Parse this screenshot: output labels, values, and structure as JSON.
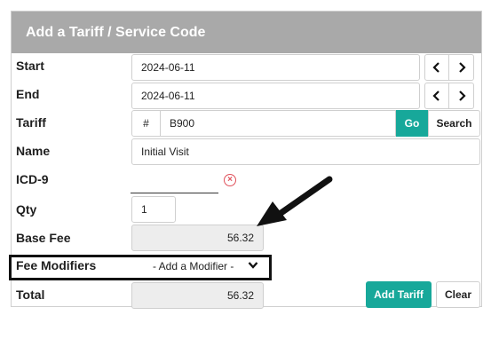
{
  "header": {
    "title": "Add a Tariff / Service Code"
  },
  "labels": {
    "start": "Start",
    "end": "End",
    "tariff": "Tariff",
    "name": "Name",
    "icd9": "ICD-9",
    "qty": "Qty",
    "base_fee": "Base Fee",
    "fee_modifiers": "Fee Modifiers",
    "total": "Total"
  },
  "fields": {
    "start_date": "2024-06-11",
    "end_date": "2024-06-11",
    "tariff_prefix": "#",
    "tariff_code": "B900",
    "name": "Initial Visit",
    "icd9": "",
    "qty": "1",
    "base_fee": "56.32",
    "fee_modifier_selected": "- Add a Modifier -",
    "total": "56.32"
  },
  "buttons": {
    "go": "Go",
    "search": "Search",
    "add_tariff": "Add Tariff",
    "clear": "Clear",
    "prev_glyph": "‹",
    "next_glyph": "›",
    "clear_icd_glyph": "×",
    "dropdown_glyph": "⌄"
  },
  "colors": {
    "header_bg": "#a9a9a9",
    "accent": "#17a89a",
    "readonly_bg": "#ededed",
    "error": "#e0505a"
  }
}
